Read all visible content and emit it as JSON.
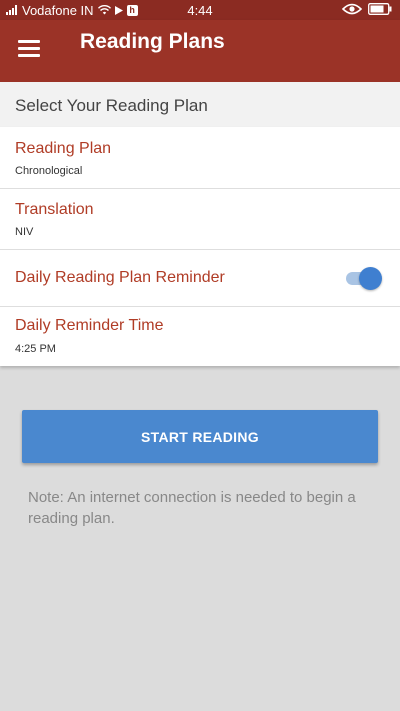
{
  "statusbar": {
    "carrier": "Vodafone IN",
    "time": "4:44",
    "icons": [
      "signal-icon",
      "wifi-icon",
      "play-icon",
      "app-badge-icon",
      "eye-icon",
      "battery-icon"
    ]
  },
  "appbar": {
    "title": "Reading Plans"
  },
  "section": {
    "header": "Select Your Reading Plan"
  },
  "settings": {
    "reading_plan": {
      "label": "Reading Plan",
      "value": "Chronological"
    },
    "translation": {
      "label": "Translation",
      "value": "NIV"
    },
    "reminder": {
      "label": "Daily Reading Plan Reminder",
      "enabled": true
    },
    "reminder_time": {
      "label": "Daily Reminder Time",
      "value": "4:25 PM"
    }
  },
  "start_button": "START READING",
  "note": "Note: An internet connection is needed to begin a reading plan.",
  "colors": {
    "appbar": "#9b3327",
    "statusbar": "#8b2b22",
    "label": "#b03c26",
    "accent": "#4a88cf"
  }
}
